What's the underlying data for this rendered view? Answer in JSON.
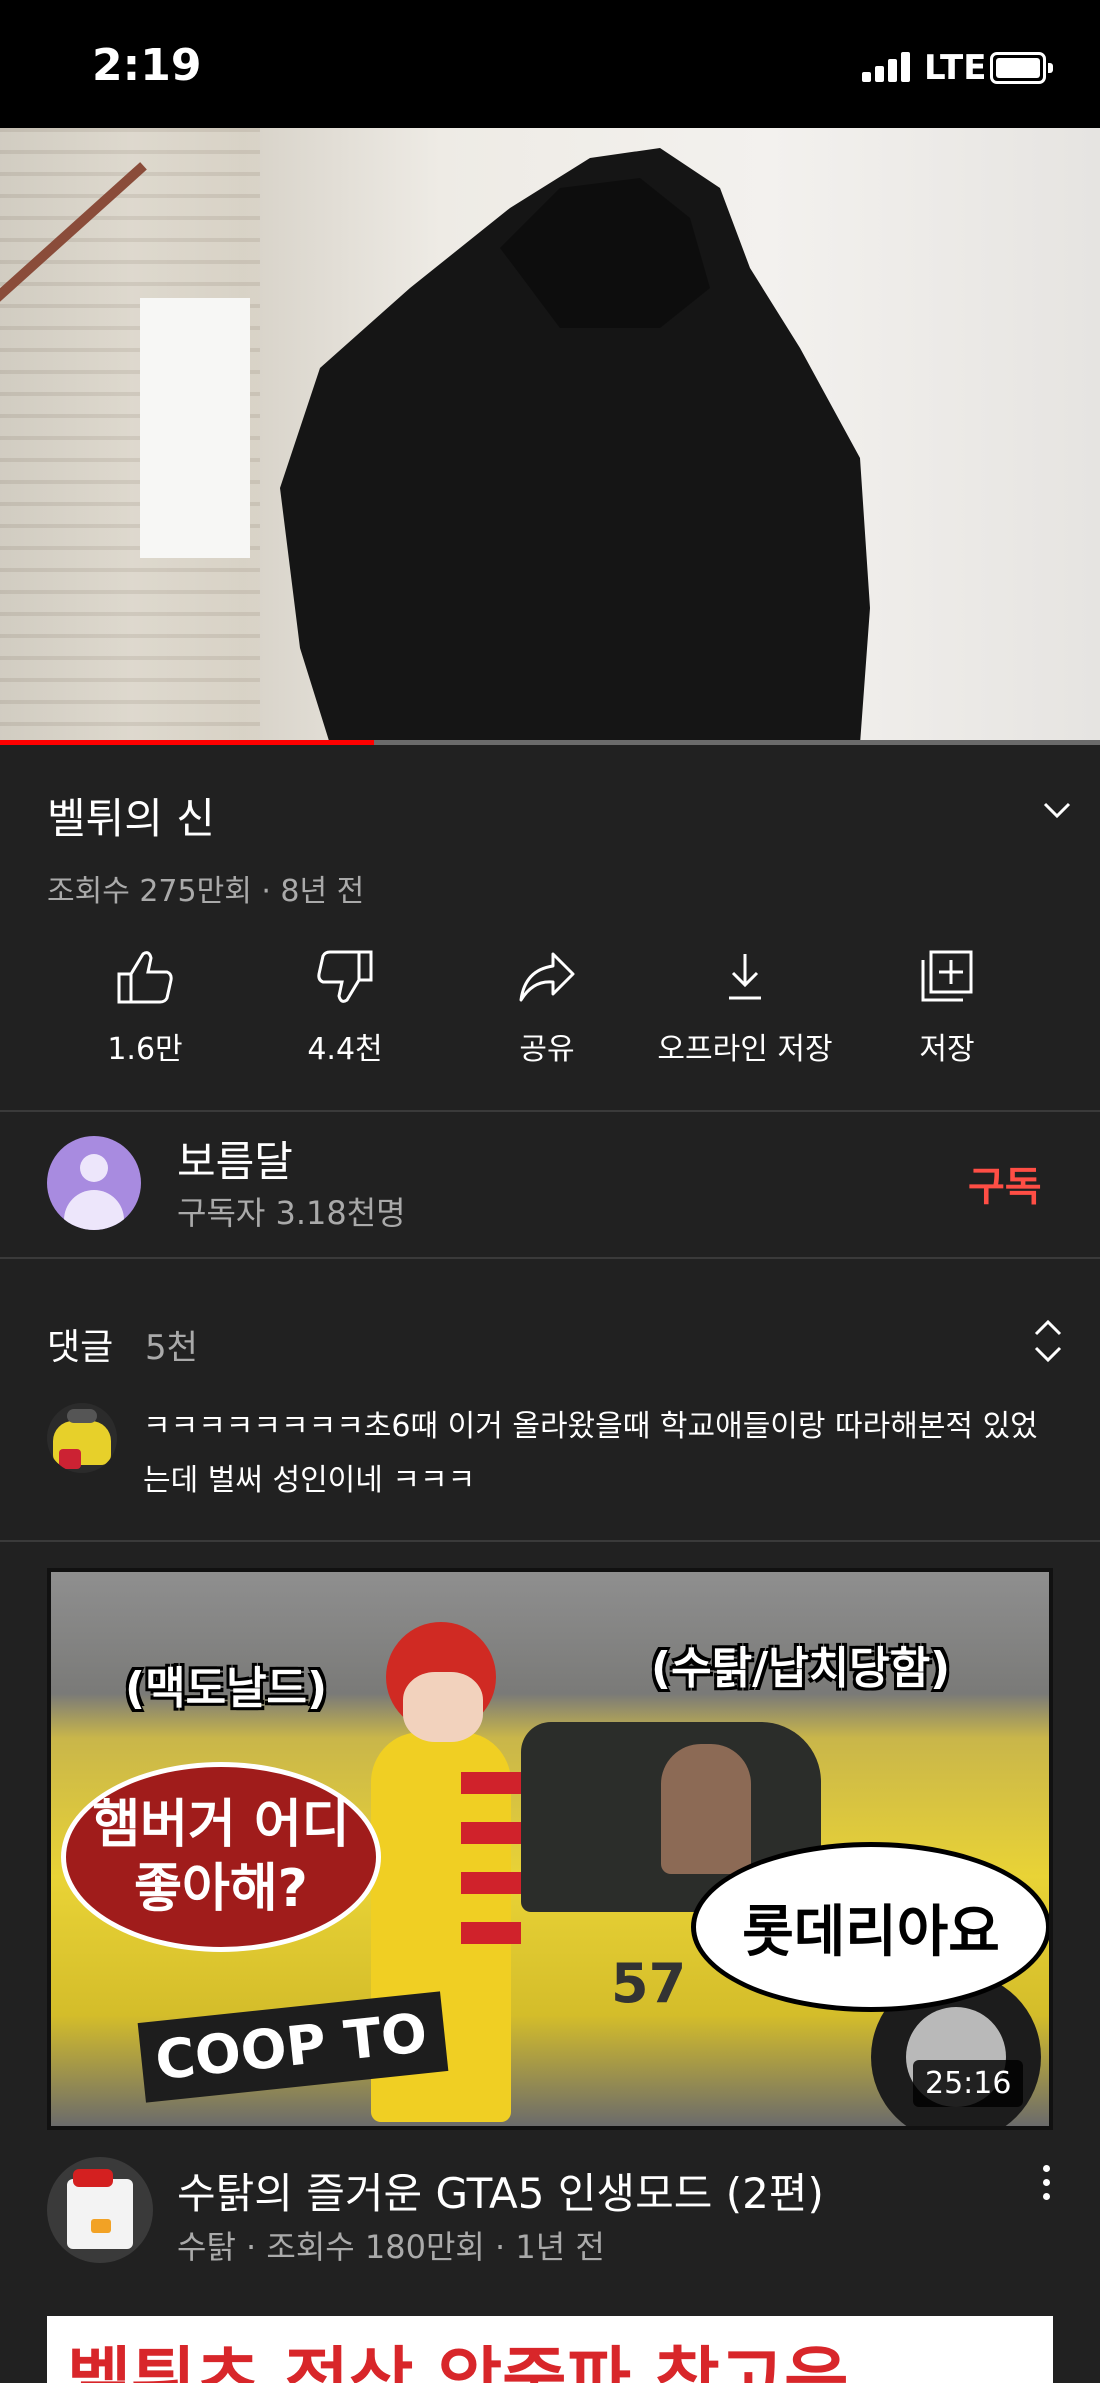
{
  "status_bar": {
    "time": "2:19",
    "network": "LTE"
  },
  "player": {
    "progress": 0.34
  },
  "video": {
    "title": "벨튀의 신",
    "meta": "조회수 275만회 · 8년 전",
    "actions": [
      {
        "icon": "thumbs-up-icon",
        "label": "1.6만"
      },
      {
        "icon": "thumbs-down-icon",
        "label": "4.4천"
      },
      {
        "icon": "share-icon",
        "label": "공유"
      },
      {
        "icon": "download-icon",
        "label": "오프라인 저장"
      },
      {
        "icon": "add-to-playlist-icon",
        "label": "저장"
      }
    ]
  },
  "channel": {
    "name": "보름달",
    "subscribers": "구독자 3.18천명",
    "subscribe_label": "구독",
    "subscribe_color": "#ff4e45"
  },
  "comments": {
    "title": "댓글",
    "count": "5천",
    "top_comment": "ㅋㅋㅋㅋㅋㅋㅋㅋ초6때 이거 올라왔을때 학교애들이랑 따라해본적 있었는데 벌써 성인이네 ㅋㅋㅋ"
  },
  "recommended": {
    "thumbnail_texts": {
      "tag_left": "(맥도날드)",
      "tag_right": "(수탉/납치당함)",
      "bubble_left": "햄버거 어디 좋아해?",
      "bubble_right": "롯데리아요",
      "coop": "COOP TO",
      "plate": "57"
    },
    "duration": "25:16",
    "title": "수탉의 즐거운 GTA5 인생모드 (2편)",
    "meta": "수탉 · 조회수 180만회 · 1년 전"
  },
  "next_thumb_text": "벨튀츠 정상 앞중파 찾고음"
}
